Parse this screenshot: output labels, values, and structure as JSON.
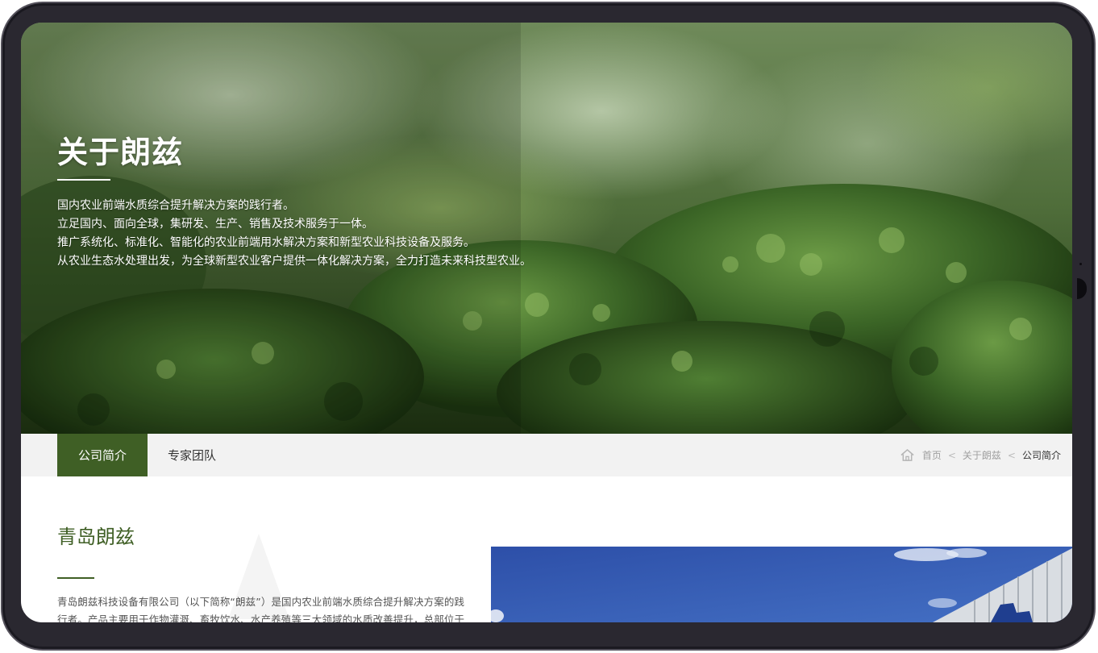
{
  "hero": {
    "title": "关于朗兹",
    "lines": [
      "国内农业前端水质综合提升解决方案的践行者。",
      "立足国内、面向全球，集研发、生产、销售及技术服务于一体。",
      "推广系统化、标准化、智能化的农业前端用水解决方案和新型农业科技设备及服务。",
      "从农业生态水处理出发，为全球新型农业客户提供一体化解决方案，全力打造未来科技型农业。"
    ]
  },
  "subnav": {
    "tabs": [
      {
        "label": "公司简介",
        "active": true
      },
      {
        "label": "专家团队",
        "active": false
      }
    ],
    "breadcrumb": {
      "icon": "home-icon",
      "items": [
        "首页",
        "关于朗兹",
        "公司简介"
      ],
      "separator": "<"
    }
  },
  "intro": {
    "title": "青岛朗兹",
    "text": "青岛朗兹科技设备有限公司（以下简称“朗兹”）是国内农业前端水质综合提升解决方案的践行者。产品主要用于作物灌溉、畜牧饮水、水产养殖等三大领域的水质改善提升，总部位于美丽的"
  },
  "colors": {
    "accent": "#3f5f25",
    "subnav_bg": "#f2f2f2",
    "device_frame": "#2a2830"
  }
}
